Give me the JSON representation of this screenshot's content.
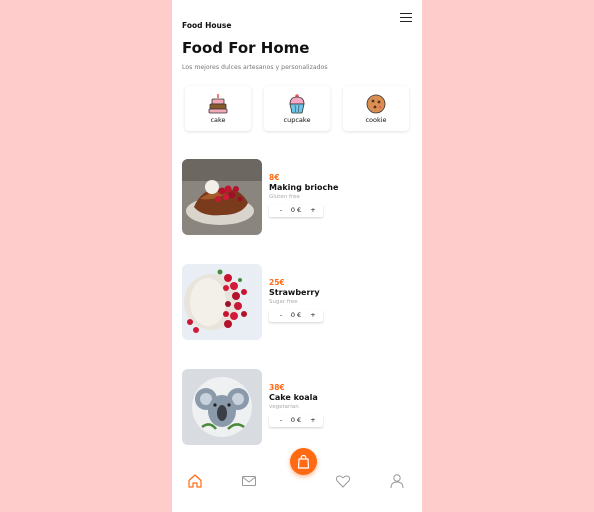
{
  "header": {
    "brand": "Food House",
    "menu_icon": "hamburger-menu-icon"
  },
  "page": {
    "title": "Food For Home",
    "subtitle": "Los mejores dulces artesanos y personalizados"
  },
  "categories": [
    {
      "label": "cake",
      "icon": "cake-icon"
    },
    {
      "label": "cupcake",
      "icon": "cupcake-icon"
    },
    {
      "label": "cookie",
      "icon": "cookie-icon"
    }
  ],
  "products": [
    {
      "price": "8€",
      "name": "Making brioche",
      "tag": "Gluten free",
      "qty": {
        "minus": "-",
        "value": "0 €",
        "plus": "+"
      }
    },
    {
      "price": "25€",
      "name": "Strawberry",
      "tag": "Sugar free",
      "qty": {
        "minus": "-",
        "value": "0 €",
        "plus": "+"
      }
    },
    {
      "price": "38€",
      "name": "Cake koala",
      "tag": "vegetarian",
      "qty": {
        "minus": "-",
        "value": "0 €",
        "plus": "+"
      }
    }
  ],
  "nav": {
    "items": [
      "home-icon",
      "mail-icon",
      "heart-icon",
      "user-icon"
    ],
    "fab_icon": "shopping-bag-icon",
    "accent": "#ff6a13"
  }
}
